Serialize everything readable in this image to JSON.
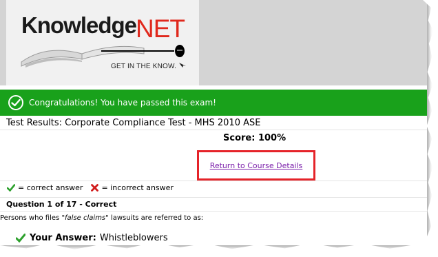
{
  "logo": {
    "brand_first": "Knowledge",
    "brand_second": "NET",
    "tagline": "GET IN THE KNOW.",
    "brand_color": "#e0281c"
  },
  "banner": {
    "message": "Congratulations! You have passed this exam!",
    "color": "#19a11b",
    "icon": "check-circle-icon"
  },
  "results": {
    "title": "Test Results: Corporate Compliance Test - MHS 2010 ASE",
    "score": "Score: 100%",
    "return_link": "Return to Course Details",
    "highlight_color": "#e52329"
  },
  "legend": {
    "correct_label": "= correct answer",
    "incorrect_label": "= incorrect answer",
    "correct_icon": "checkmark-icon",
    "incorrect_icon": "x-mark-icon"
  },
  "question": {
    "heading": "Question 1 of 17 - Correct",
    "text_before": "Persons who files ",
    "text_emphasis": "\"false claims\"",
    "text_after": " lawsuits are referred to as:",
    "answer_label": "Your Answer:",
    "answer_value": "Whistleblowers"
  }
}
